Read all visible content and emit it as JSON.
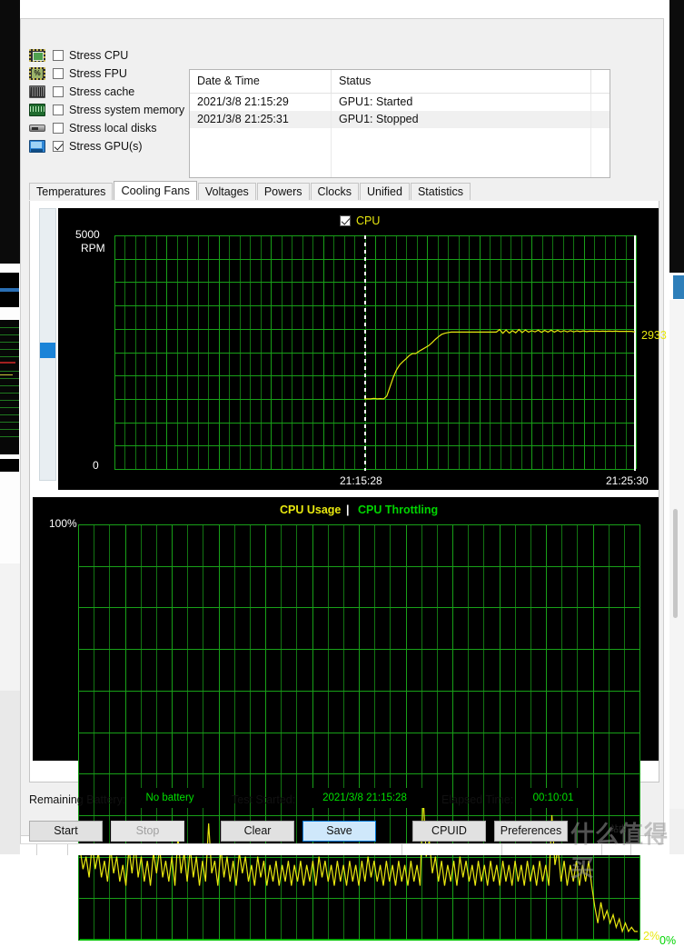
{
  "stress_options": [
    {
      "label": "Stress CPU",
      "icon": "cpu-icon",
      "checked": false
    },
    {
      "label": "Stress FPU",
      "icon": "fpu-icon",
      "checked": false
    },
    {
      "label": "Stress cache",
      "icon": "cache-icon",
      "checked": false
    },
    {
      "label": "Stress system memory",
      "icon": "memory-icon",
      "checked": false
    },
    {
      "label": "Stress local disks",
      "icon": "disk-icon",
      "checked": false
    },
    {
      "label": "Stress GPU(s)",
      "icon": "gpu-icon",
      "checked": true
    }
  ],
  "log_table": {
    "columns": [
      "Date & Time",
      "Status",
      ""
    ],
    "rows": [
      {
        "datetime": "2021/3/8 21:15:29",
        "status": "GPU1: Started",
        "extra": ""
      },
      {
        "datetime": "2021/3/8 21:25:31",
        "status": "GPU1: Stopped",
        "extra": ""
      },
      {
        "datetime": "",
        "status": "",
        "extra": ""
      },
      {
        "datetime": "",
        "status": "",
        "extra": ""
      },
      {
        "datetime": "",
        "status": "",
        "extra": ""
      }
    ]
  },
  "tabs": [
    {
      "label": "Temperatures",
      "active": false
    },
    {
      "label": "Cooling Fans",
      "active": true
    },
    {
      "label": "Voltages",
      "active": false
    },
    {
      "label": "Powers",
      "active": false
    },
    {
      "label": "Clocks",
      "active": false
    },
    {
      "label": "Unified",
      "active": false
    },
    {
      "label": "Statistics",
      "active": false
    }
  ],
  "chart_data": [
    {
      "type": "line",
      "name": "cooling-fans-chart",
      "title": "",
      "legend": [
        {
          "label": "CPU",
          "color": "#e8e80f",
          "checked": true
        }
      ],
      "legend_position": "top-center",
      "ylabel": "RPM",
      "ytick_labels": [
        "5000\nRPM",
        "0"
      ],
      "ylim": [
        0,
        5000
      ],
      "grid": true,
      "grid_color": "#18a018",
      "xtick_labels": [
        "21:15:28",
        "21:25:30"
      ],
      "x_cursor_labels": [
        "21:15:28",
        "21:25:30"
      ],
      "current_value_label": "2933",
      "current_value_color": "#e8e80f",
      "series": [
        {
          "name": "CPU",
          "color": "#e8e80f",
          "unit": "RPM",
          "points": [
            1500,
            1500,
            1500,
            1510,
            1500,
            1505,
            1500,
            1560,
            1760,
            1960,
            2120,
            2230,
            2300,
            2360,
            2430,
            2470,
            2470,
            2520,
            2560,
            2600,
            2640,
            2700,
            2770,
            2830,
            2880,
            2905,
            2920,
            2930,
            2930,
            2930,
            2930,
            2930,
            2930,
            2930,
            2930,
            2930,
            2930,
            2930,
            2930,
            2930,
            2930,
            2930,
            2985,
            2905,
            2975,
            2910,
            2960,
            2915,
            2985,
            2920,
            2975,
            2930,
            2960,
            2935,
            2970,
            2925,
            2965,
            2930,
            2970,
            2930,
            2965,
            2935,
            2960,
            2935,
            2960,
            2935,
            2955,
            2940,
            2955,
            2940,
            2950,
            2945,
            2950,
            2945,
            2950,
            2945,
            2950,
            2945,
            2950,
            2945,
            2945,
            2945,
            2945,
            2945,
            2933
          ]
        }
      ]
    },
    {
      "type": "line",
      "name": "cpu-usage-chart",
      "title": "",
      "legend": [
        {
          "label": "CPU Usage",
          "color": "#e8e80f"
        },
        {
          "label": "CPU Throttling",
          "color": "#00d400"
        }
      ],
      "legend_separator": "|",
      "legend_position": "top-center",
      "ylabel": "%",
      "ytick_labels": [
        "100%",
        "0%"
      ],
      "ylim": [
        0,
        100
      ],
      "grid": true,
      "grid_color": "#18a018",
      "current_value_labels": [
        {
          "text": "2%",
          "color": "#e8e80f"
        },
        {
          "text": "0%",
          "color": "#00d400"
        }
      ],
      "series": [
        {
          "name": "CPU Usage",
          "color": "#e8e80f",
          "unit": "%",
          "points": [
            22,
            17,
            20,
            15,
            23,
            17,
            21,
            15,
            19,
            14,
            22,
            16,
            20,
            14,
            18,
            13,
            22,
            16,
            23,
            15,
            20,
            14,
            19,
            13,
            21,
            16,
            22,
            15,
            19,
            14,
            20,
            13,
            25,
            16,
            21,
            14,
            22,
            15,
            20,
            13,
            19,
            14,
            28,
            16,
            19,
            13,
            22,
            15,
            20,
            14,
            19,
            13,
            21,
            16,
            20,
            14,
            18,
            13,
            20,
            15,
            19,
            13,
            18,
            14,
            19,
            13,
            18,
            14,
            19,
            13,
            18,
            14,
            19,
            13,
            18,
            14,
            19,
            13,
            20,
            15,
            19,
            14,
            18,
            13,
            19,
            14,
            18,
            13,
            19,
            14,
            18,
            13,
            19,
            14,
            20,
            15,
            19,
            14,
            18,
            13,
            19,
            14,
            18,
            13,
            19,
            14,
            18,
            13,
            19,
            14,
            18,
            13,
            35,
            20,
            24,
            16,
            20,
            14,
            19,
            13,
            18,
            14,
            19,
            13,
            20,
            15,
            19,
            14,
            18,
            13,
            19,
            14,
            18,
            13,
            19,
            14,
            18,
            13,
            19,
            14,
            18,
            13,
            19,
            14,
            18,
            13,
            19,
            14,
            18,
            13,
            19,
            14,
            18,
            13,
            30,
            18,
            22,
            14,
            19,
            13,
            18,
            14,
            19,
            13,
            18,
            14,
            19,
            13,
            8,
            4,
            9,
            5,
            7,
            4,
            6,
            3,
            5,
            2,
            4,
            2,
            3,
            2,
            2
          ]
        },
        {
          "name": "CPU Throttling",
          "color": "#00d400",
          "unit": "%",
          "points": [
            0,
            0,
            0,
            0,
            0,
            0,
            0,
            0,
            0,
            0,
            0,
            0
          ]
        }
      ]
    }
  ],
  "status_bar": {
    "battery_label": "Remaining Battery:",
    "battery_value": "No battery",
    "test_started_label": "Test Started:",
    "test_started_value": "2021/3/8 21:15:28",
    "elapsed_label": "Elapsed Time:",
    "elapsed_value": "00:10:01"
  },
  "buttons": [
    {
      "label": "Start",
      "state": "normal"
    },
    {
      "label": "Stop",
      "state": "disabled"
    },
    {
      "label": "Clear",
      "state": "normal"
    },
    {
      "label": "Save",
      "state": "primary"
    },
    {
      "label": "CPUID",
      "state": "normal"
    },
    {
      "label": "Preferences",
      "state": "normal"
    }
  ],
  "watermark": {
    "text": "什么值得买",
    "small": "站内"
  }
}
